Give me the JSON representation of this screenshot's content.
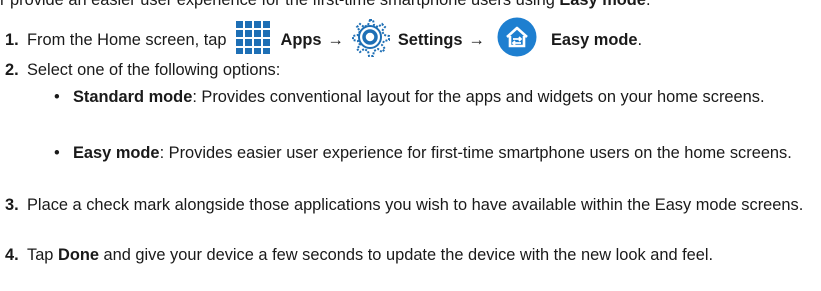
{
  "intro": {
    "text": "r provide an easier user experience for the first-time smartphone users using ",
    "bold_tail": "Easy mode",
    "end": "."
  },
  "steps": [
    {
      "num": "1.",
      "prefix": "From the Home screen, tap",
      "apps_label": "Apps",
      "arrow1": "→",
      "settings_label": "Settings",
      "arrow2": "→",
      "easy_label": "Easy mode",
      "end": "."
    },
    {
      "num": "2.",
      "text": "Select one of the following options:"
    },
    {
      "num": "3.",
      "text": "Place a check mark alongside those applications you wish to have available within the Easy mode screens."
    },
    {
      "num": "4.",
      "pre": "Tap ",
      "bold": "Done",
      "post": " and give your device a few seconds to update the device with the new look and feel."
    }
  ],
  "options": [
    {
      "bullet": "•",
      "title": "Standard mode",
      "desc": ": Provides conventional layout for the apps and widgets on your home screens."
    },
    {
      "bullet": "•",
      "title": "Easy mode",
      "desc": ": Provides easier user experience for first-time smartphone users on the home screens."
    }
  ],
  "icons": {
    "apps": "apps-grid-icon",
    "settings": "settings-gear-icon",
    "easy_mode": "easy-mode-icon",
    "apps_color": "#1e6fb5",
    "easy_color": "#1e7fd0"
  }
}
